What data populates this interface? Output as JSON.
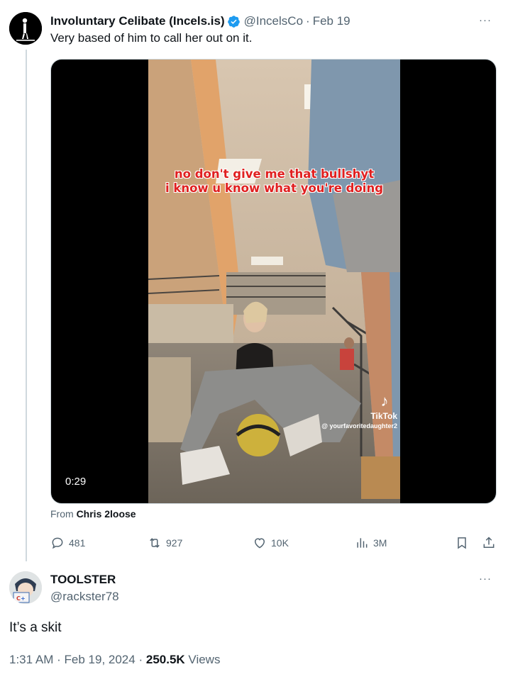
{
  "tweet1": {
    "display_name": "Involuntary Celibate (Incels.is)",
    "handle": "@IncelsCo",
    "separator": "·",
    "date": "Feb 19",
    "text": "Very based of him to call her out on it.",
    "verified_color": "#1d9bf0",
    "media": {
      "caption_line1": "no don't give me that bullshyt",
      "caption_line2": "i know u know what you're doing",
      "watermark_label": "TikTok",
      "watermark_user": "@ yourfavoritedaughter2",
      "duration": "0:29"
    },
    "from_prefix": "From",
    "from_user": "Chris 2loose",
    "stats": {
      "replies": "481",
      "reposts": "927",
      "likes": "10K",
      "views": "3M"
    },
    "more_label": "···"
  },
  "tweet2": {
    "display_name": "TOOLSTER",
    "handle": "@rackster78",
    "text": "It’s a skit",
    "time": "1:31 AM",
    "separator": "·",
    "date": "Feb 19, 2024",
    "views_count": "250.5K",
    "views_label": "Views",
    "more_label": "···"
  },
  "icons": [
    "more-icon",
    "verified-icon",
    "reply-icon",
    "repost-icon",
    "like-icon",
    "views-icon",
    "bookmark-icon",
    "share-icon",
    "tiktok-icon"
  ],
  "colors": {
    "text": "#0f1419",
    "secondary": "#536471",
    "border": "#cfd9de",
    "accent": "#1d9bf0"
  }
}
